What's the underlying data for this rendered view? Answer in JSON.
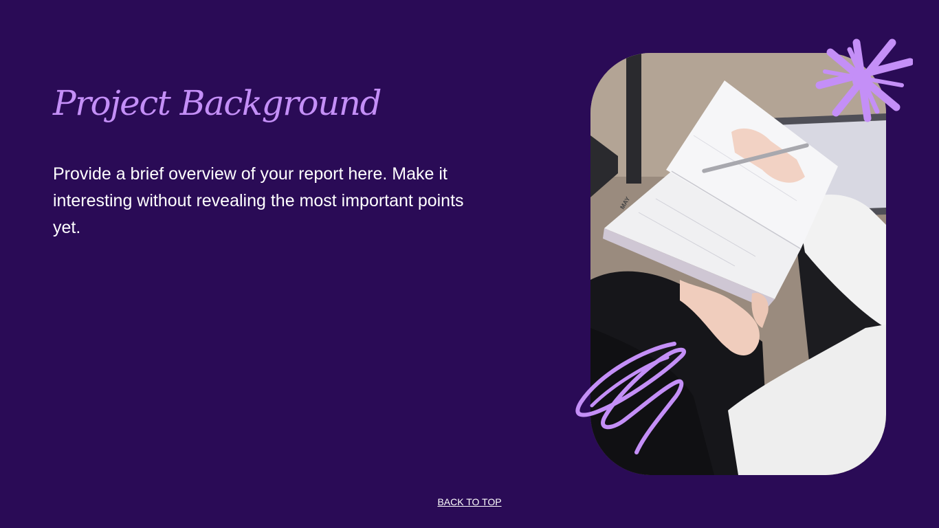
{
  "slide": {
    "title": "Project Background",
    "body": "Provide a brief overview of your report here. Make it interesting without revealing the most important points yet."
  },
  "nav": {
    "back_to_top": "BACK TO TOP"
  },
  "photo": {
    "planner_month": "MAY"
  },
  "colors": {
    "background": "#2a0b56",
    "accent": "#c48ff7",
    "text": "#ffffff"
  },
  "icons": {
    "star": "sparkle-star-icon",
    "scribble": "scribble-icon"
  }
}
